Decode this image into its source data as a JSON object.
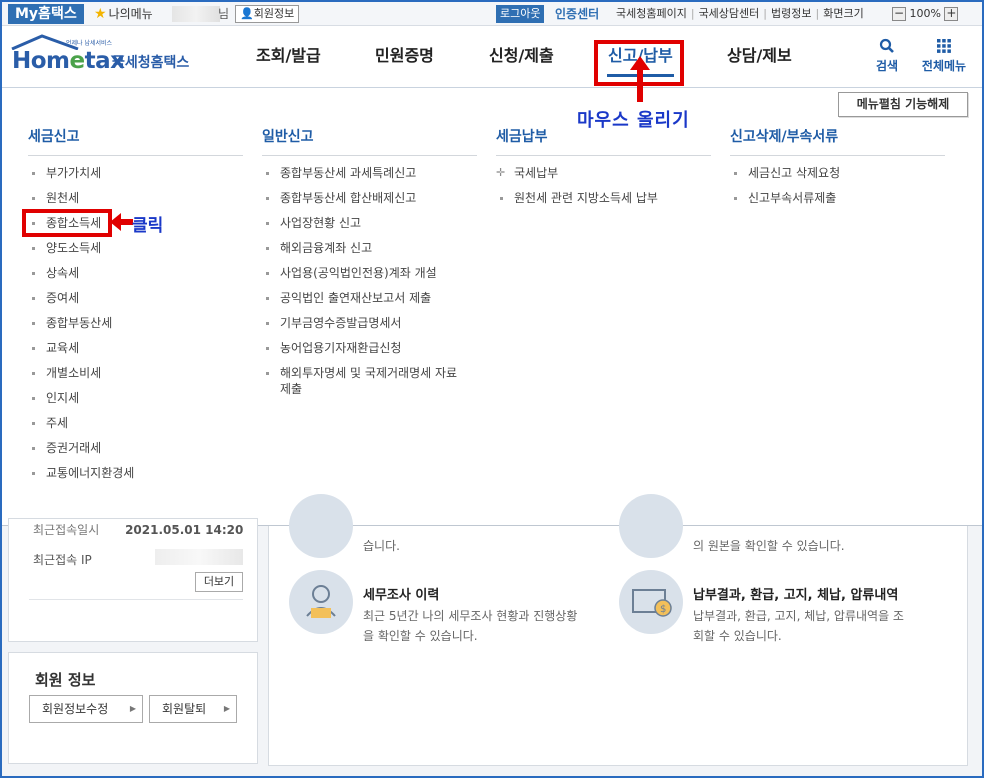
{
  "topbar": {
    "my_hometax": "My홈택스",
    "my_menu": "나의메뉴",
    "name_suffix": "님",
    "member_info": "회원정보",
    "logout": "로그아웃",
    "cert_center": "인증센터",
    "links": [
      "국세청홈페이지",
      "국세상담센터",
      "법령정보",
      "화면크기"
    ],
    "zoom_level": "100%"
  },
  "logo": {
    "small_text": "언제나 납세서비스",
    "brand": "Hometax",
    "brand_ko": "국세청홈택스"
  },
  "gnb": [
    {
      "label": "조회/발급"
    },
    {
      "label": "민원증명"
    },
    {
      "label": "신청/제출"
    },
    {
      "label": "신고/납부",
      "active": true
    },
    {
      "label": "상담/제보"
    }
  ],
  "header_buttons": {
    "search": "검색",
    "all_menu": "전체메뉴"
  },
  "dropdown": {
    "fold_button": "메뉴펼침 기능해제",
    "columns": [
      {
        "title": "세금신고",
        "items": [
          "부가가치세",
          "원천세",
          "종합소득세",
          "양도소득세",
          "상속세",
          "증여세",
          "종합부동산세",
          "교육세",
          "개별소비세",
          "인지세",
          "주세",
          "증권거래세",
          "교통에너지환경세"
        ]
      },
      {
        "title": "일반신고",
        "items": [
          "종합부동산세 과세특례신고",
          "종합부동산세 합산배제신고",
          "사업장현황 신고",
          "해외금융계좌 신고",
          "사업용(공익법인전용)계좌 개설",
          "공익법인 출연재산보고서 제출",
          "기부금영수증발급명세서",
          "농어업용기자재환급신청",
          "해외투자명세 및 국제거래명세 자료 제출"
        ]
      },
      {
        "title": "세금납부",
        "items": [
          "국세납부",
          "원천세 관련 지방소득세 납부"
        ]
      },
      {
        "title": "신고삭제/부속서류",
        "items": [
          "세금신고 삭제요청",
          "신고부속서류제출"
        ]
      }
    ]
  },
  "annotations": {
    "hover": "마우스 올리기",
    "click": "클릭"
  },
  "background": {
    "last_login_label": "최근접속일시",
    "last_login_value": "2021.05.01 14:20",
    "last_ip_label": "최근접속 IP",
    "more": "더보기",
    "member_title": "회원 정보",
    "edit_member": "회원정보수정",
    "withdraw": "회원탈퇴",
    "svc_top_left_desc": "습니다.",
    "svc_top_right_desc": "의 원본을 확인할 수 있습니다.",
    "svc1_title": "세무조사 이력",
    "svc1_desc": "최근 5년간 나의 세무조사 현황과 진행상황을 확인할 수 있습니다.",
    "svc2_title": "납부결과, 환급, 고지, 체납, 압류내역",
    "svc2_desc": "납부결과, 환급, 고지, 체납, 압류내역을 조회할 수 있습니다."
  },
  "colors": {
    "brand_blue": "#1f5ca6",
    "annotation_red": "#e00000",
    "annotation_text": "#1a38c8"
  }
}
